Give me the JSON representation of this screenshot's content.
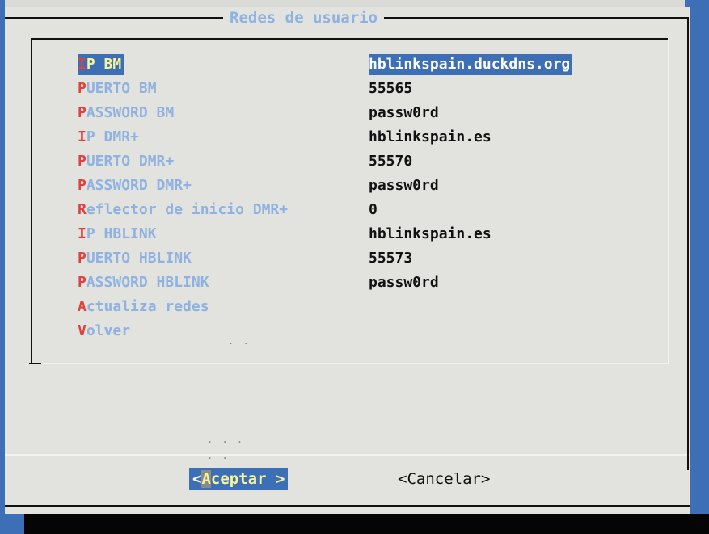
{
  "dialog": {
    "title": "Redes de usuario"
  },
  "menu": [
    {
      "hot": "I",
      "rest": "P BM",
      "value": "hblinkspain.duckdns.org",
      "selected": true
    },
    {
      "hot": "P",
      "rest": "UERTO BM",
      "value": "55565"
    },
    {
      "hot": "P",
      "rest": "ASSWORD BM",
      "value": "passw0rd"
    },
    {
      "hot": "I",
      "rest": "P DMR+",
      "value": "hblinkspain.es"
    },
    {
      "hot": "P",
      "rest": "UERTO DMR+",
      "value": "55570"
    },
    {
      "hot": "P",
      "rest": "ASSWORD DMR+",
      "value": "passw0rd"
    },
    {
      "hot": "R",
      "rest": "eflector de inicio DMR+",
      "value": "0"
    },
    {
      "hot": "I",
      "rest": "P HBLINK",
      "value": "hblinkspain.es"
    },
    {
      "hot": "P",
      "rest": "UERTO HBLINK",
      "value": "55573"
    },
    {
      "hot": "P",
      "rest": "ASSWORD HBLINK",
      "value": "passw0rd"
    },
    {
      "hot": "A",
      "rest": "ctualiza redes",
      "value": ""
    },
    {
      "hot": "V",
      "rest": "olver",
      "value": ""
    }
  ],
  "buttons": {
    "ok": {
      "open": "<",
      "hot": "A",
      "rest": "ceptar",
      "close": " >"
    },
    "cancel": {
      "label": "<Cancelar>"
    }
  },
  "colors": {
    "accent": "#3d6fb6",
    "label": "#8fb2e0",
    "hotkey": "#e0413c",
    "highlight_text": "#f7f39a",
    "dialog_bg": "#e2e2df"
  }
}
